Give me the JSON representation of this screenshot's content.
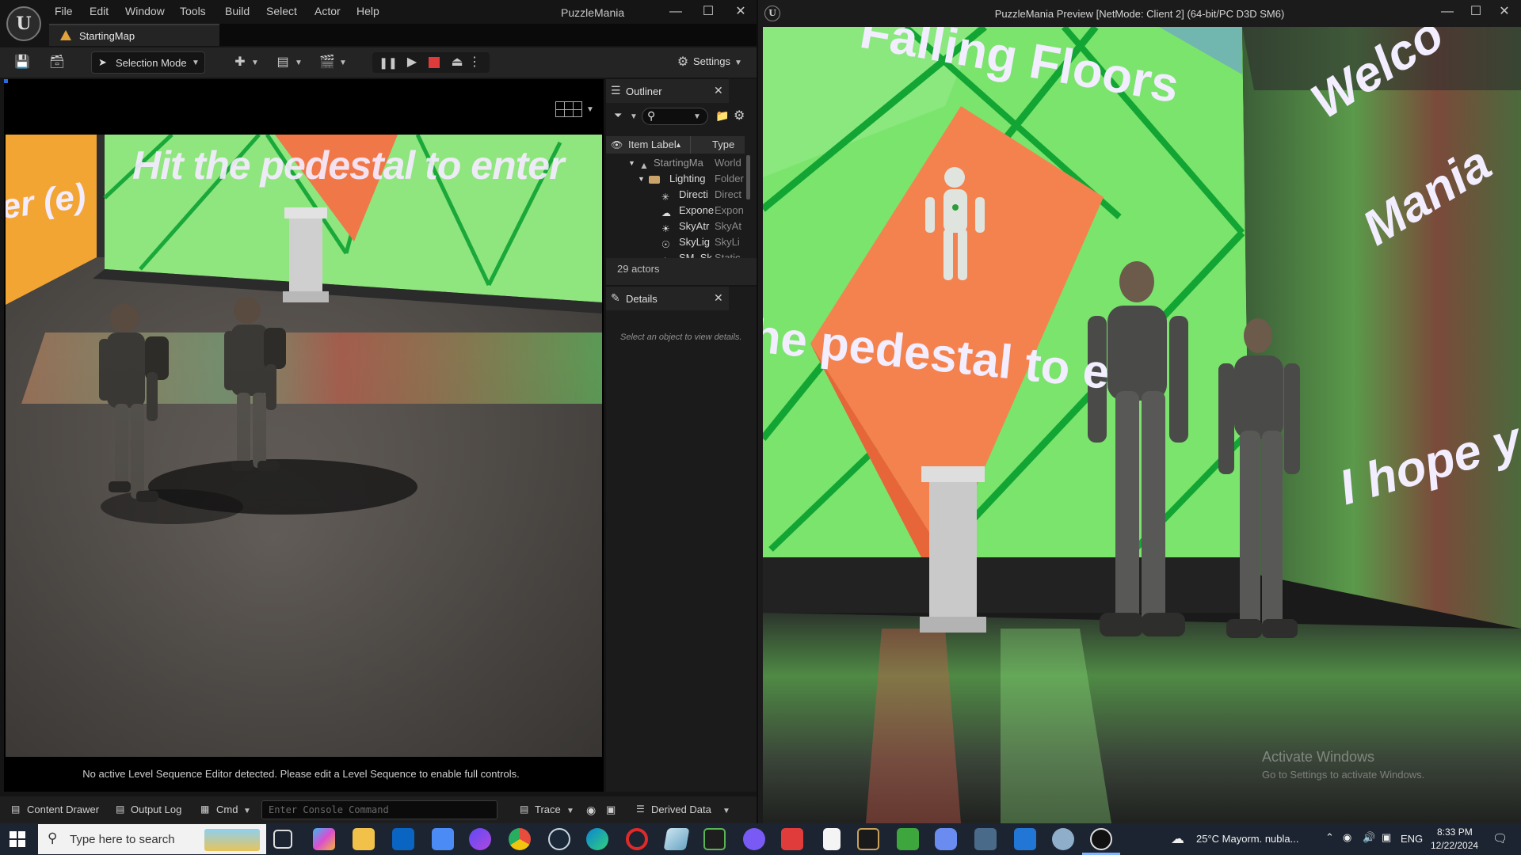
{
  "editor": {
    "menu": [
      "File",
      "Edit",
      "Window",
      "Tools",
      "Build",
      "Select",
      "Actor",
      "Help"
    ],
    "title": "PuzzleMania",
    "tab_label": "StartingMap",
    "selection_mode": "Selection Mode",
    "settings_label": "Settings",
    "sequence_message": "No active Level Sequence Editor detected. Please edit a Level Sequence to enable full controls.",
    "viewport_text": {
      "headline": "Hit the pedestal to enter",
      "side": "er (e)"
    }
  },
  "outliner": {
    "tab_label": "Outliner",
    "columns": {
      "label": "Item Label",
      "type": "Type"
    },
    "rows": [
      {
        "label": "StartingMa",
        "type": "World",
        "icon": "world-icon"
      },
      {
        "label": "Lighting",
        "type": "Folder",
        "icon": "folder-icon"
      },
      {
        "label": "Directi",
        "type": "Direct",
        "icon": "light-icon"
      },
      {
        "label": "Expone",
        "type": "Expon",
        "icon": "fog-icon"
      },
      {
        "label": "SkyAtr",
        "type": "SkyAt",
        "icon": "sky-icon"
      },
      {
        "label": "SkyLig",
        "type": "SkyLi",
        "icon": "skylight-icon"
      },
      {
        "label": "SM_Sk",
        "type": "Static",
        "icon": "mesh-icon"
      }
    ],
    "actor_count": "29 actors"
  },
  "details": {
    "tab_label": "Details",
    "empty_message": "Select an object to view details."
  },
  "statusbar": {
    "content_drawer": "Content Drawer",
    "output_log": "Output Log",
    "cmd": "Cmd",
    "console_placeholder": "Enter Console Command",
    "trace": "Trace",
    "derived_data": "Derived Data"
  },
  "preview": {
    "title": "PuzzleMania Preview [NetMode: Client 2]  (64-bit/PC D3D SM6)",
    "texts": {
      "falling": "Falling Floors",
      "pedestal": "he pedestal to e",
      "welcome": "Welco",
      "mania": "Mania",
      "hope": "I hope yo"
    },
    "activate_title": "Activate Windows",
    "activate_sub": "Go to Settings to activate Windows."
  },
  "taskbar": {
    "search_placeholder": "Type here to search",
    "weather": "25°C  Mayorm. nubla...",
    "lang": "ENG",
    "time": "8:33 PM",
    "date": "12/22/2024"
  },
  "colors": {
    "accent": "#e2a13b",
    "stop_red": "#e03b3b",
    "screen_green": "#5fe05a",
    "tile_orange": "#f07848"
  }
}
